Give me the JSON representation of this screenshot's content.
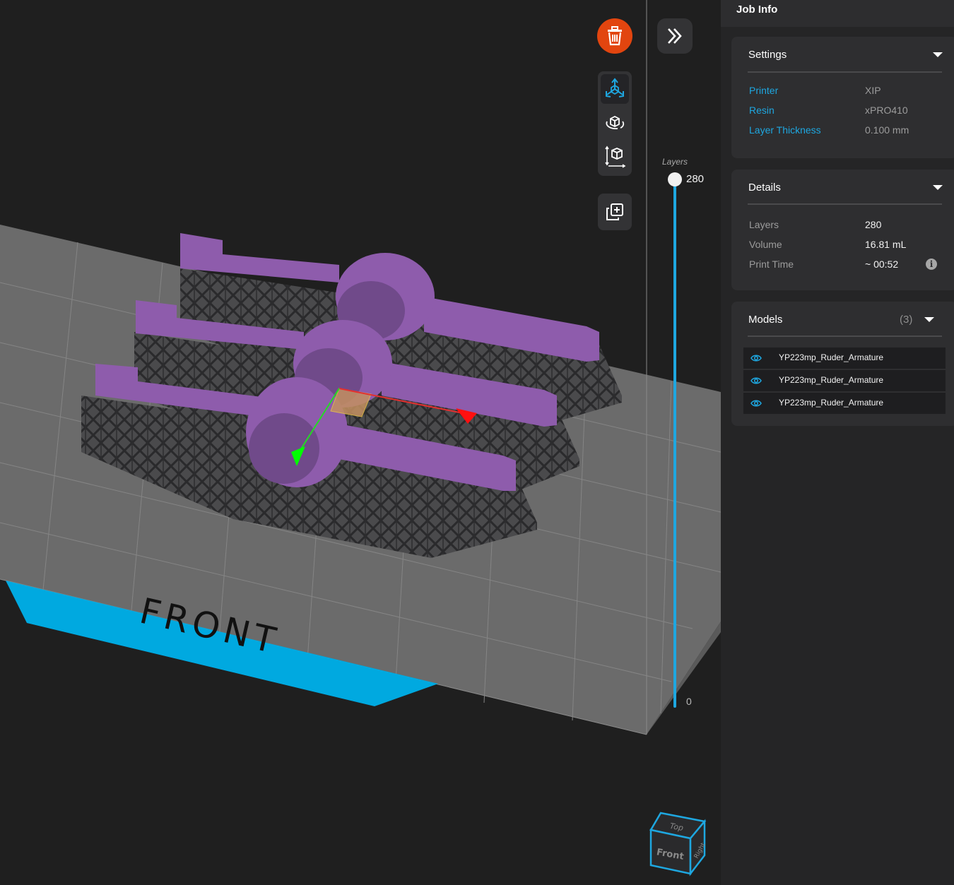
{
  "viewport": {
    "bed_label": "FRONT",
    "layers_slider": {
      "label": "Layers",
      "top_value": "280",
      "bottom_value": "0",
      "position_fraction": 1.0
    },
    "view_cube": {
      "top": "Top",
      "front": "Front",
      "right": "Right"
    },
    "toolbar": {
      "delete_icon": "trash-icon",
      "collapse_icon": "double-chevron-right-icon",
      "move_icon": "move-axes-icon",
      "rotate_icon": "rotate-cube-icon",
      "scale_icon": "scale-cube-icon",
      "duplicate_icon": "duplicate-icon"
    }
  },
  "panel": {
    "title": "Job Info",
    "settings": {
      "title": "Settings",
      "rows": [
        {
          "key": "Printer",
          "value": "XIP"
        },
        {
          "key": "Resin",
          "value": "xPRO410"
        },
        {
          "key": "Layer Thickness",
          "value": "0.100 mm"
        }
      ]
    },
    "details": {
      "title": "Details",
      "rows": [
        {
          "key": "Layers",
          "value": "280"
        },
        {
          "key": "Volume",
          "value": "16.81 mL"
        },
        {
          "key": "Print Time",
          "value": "~ 00:52"
        }
      ],
      "info_icon": "i"
    },
    "models": {
      "title": "Models",
      "count": "(3)",
      "items": [
        {
          "name": "YP223mp_Ruder_Armature"
        },
        {
          "name": "YP223mp_Ruder_Armature"
        },
        {
          "name": "YP223mp_Ruder_Armature"
        }
      ]
    }
  },
  "colors": {
    "accent": "#1ea7e0",
    "delete": "#e2450f",
    "model": "#8e5cac",
    "support": "#3a3a3c",
    "bed": "#6b6b6b"
  }
}
